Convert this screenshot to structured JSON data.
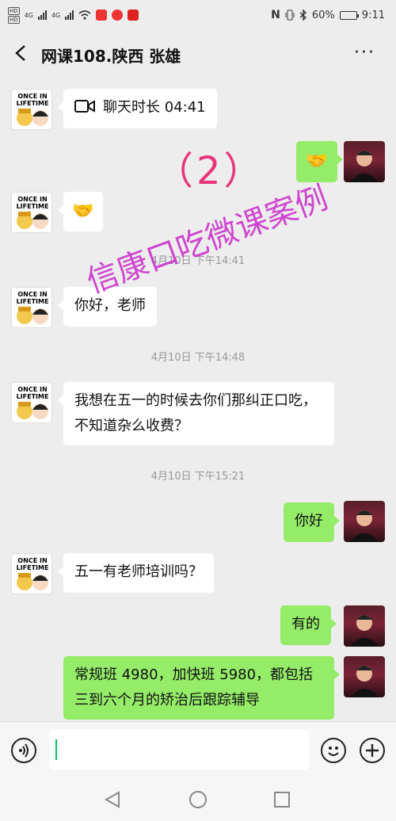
{
  "status_bar": {
    "hd1": "HD",
    "hd2": "HD",
    "net1": "4G",
    "net2": "4G",
    "battery_text": "60%",
    "battery_level": 0.6,
    "time": "9:11",
    "icons": [
      "signal-icon",
      "wifi-icon",
      "nfc-icon",
      "vibrate-icon",
      "bluetooth-icon"
    ]
  },
  "header": {
    "title": "网课108.陕西 张雄",
    "more_label": "···"
  },
  "overlay": {
    "label": "（2）",
    "watermark": "信康口吃微课案例"
  },
  "messages": [
    {
      "side": "left",
      "type": "call",
      "text": "聊天时长 04:41"
    },
    {
      "side": "right",
      "type": "emoji",
      "text": "🤝"
    },
    {
      "side": "left",
      "type": "emoji",
      "text": "🤝"
    },
    {
      "type": "time",
      "text": "4月10日 下午14:41"
    },
    {
      "side": "left",
      "type": "text",
      "text": "你好，老师"
    },
    {
      "type": "time",
      "text": "4月10日 下午14:48"
    },
    {
      "side": "left",
      "type": "text",
      "text": "我想在五一的时候去你们那纠正口吃，不知道杂么收费？"
    },
    {
      "type": "time",
      "text": "4月10日 下午15:21"
    },
    {
      "side": "right",
      "type": "text",
      "text": "你好"
    },
    {
      "side": "left",
      "type": "text",
      "text": "五一有老师培训吗？"
    },
    {
      "side": "right",
      "type": "text",
      "text": "有的"
    },
    {
      "side": "right",
      "type": "text",
      "text": "常规班 4980，加快班 5980，都包括三到六个月的矫治后跟踪辅导"
    }
  ],
  "avatar_user": {
    "line1": "ONCE IN",
    "line2": "LIFETIME"
  },
  "colors": {
    "green_bubble": "#95ec69",
    "accent": "#07c160",
    "overlay_pink": "#e8357a",
    "watermark": "#cc33cc"
  }
}
